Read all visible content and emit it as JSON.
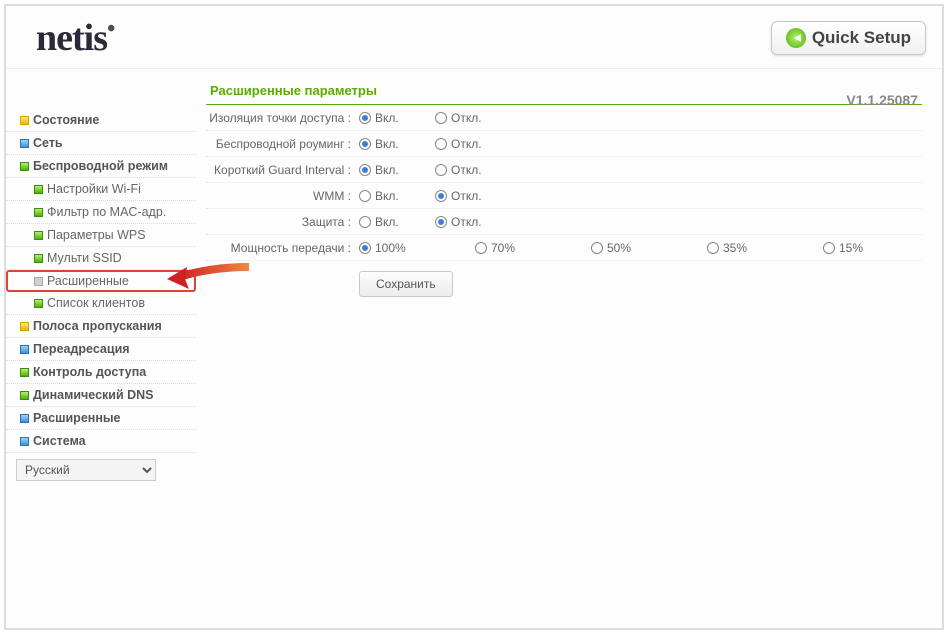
{
  "header": {
    "brand": "netis",
    "quick_setup": "Quick Setup"
  },
  "version": "V1.1.25087",
  "sidebar": {
    "items": [
      {
        "label": "Состояние",
        "bullet": "b-yellow"
      },
      {
        "label": "Сеть",
        "bullet": "b-blue"
      },
      {
        "label": "Беспроводной режим",
        "bullet": "b-green",
        "sub": [
          {
            "label": "Настройки Wi-Fi",
            "bullet": "b-green"
          },
          {
            "label": "Фильтр по MAC-адр.",
            "bullet": "b-green"
          },
          {
            "label": "Параметры WPS",
            "bullet": "b-green"
          },
          {
            "label": "Мульти SSID",
            "bullet": "b-green"
          },
          {
            "label": "Расширенные",
            "bullet": "b-grey",
            "highlighted": true
          },
          {
            "label": "Список клиентов",
            "bullet": "b-green"
          }
        ]
      },
      {
        "label": "Полоса пропускания",
        "bullet": "b-yellow"
      },
      {
        "label": "Переадресация",
        "bullet": "b-blue"
      },
      {
        "label": "Контроль доступа",
        "bullet": "b-green"
      },
      {
        "label": "Динамический DNS",
        "bullet": "b-green"
      },
      {
        "label": "Расширенные",
        "bullet": "b-blue"
      },
      {
        "label": "Система",
        "bullet": "b-blue"
      }
    ],
    "language": "Русский"
  },
  "content": {
    "title": "Расширенные параметры",
    "on": "Вкл.",
    "off": "Откл.",
    "rows": [
      {
        "label": "Изоляция точки доступа :",
        "selected": "on"
      },
      {
        "label": "Беспроводной роуминг :",
        "selected": "on"
      },
      {
        "label": "Короткий Guard Interval :",
        "selected": "on"
      },
      {
        "label": "WMM :",
        "selected": "off"
      },
      {
        "label": "Защита :",
        "selected": "off"
      }
    ],
    "tx_power": {
      "label": "Мощность передачи :",
      "options": [
        "100%",
        "70%",
        "50%",
        "35%",
        "15%"
      ],
      "selected": "100%"
    },
    "save": "Сохранить"
  }
}
